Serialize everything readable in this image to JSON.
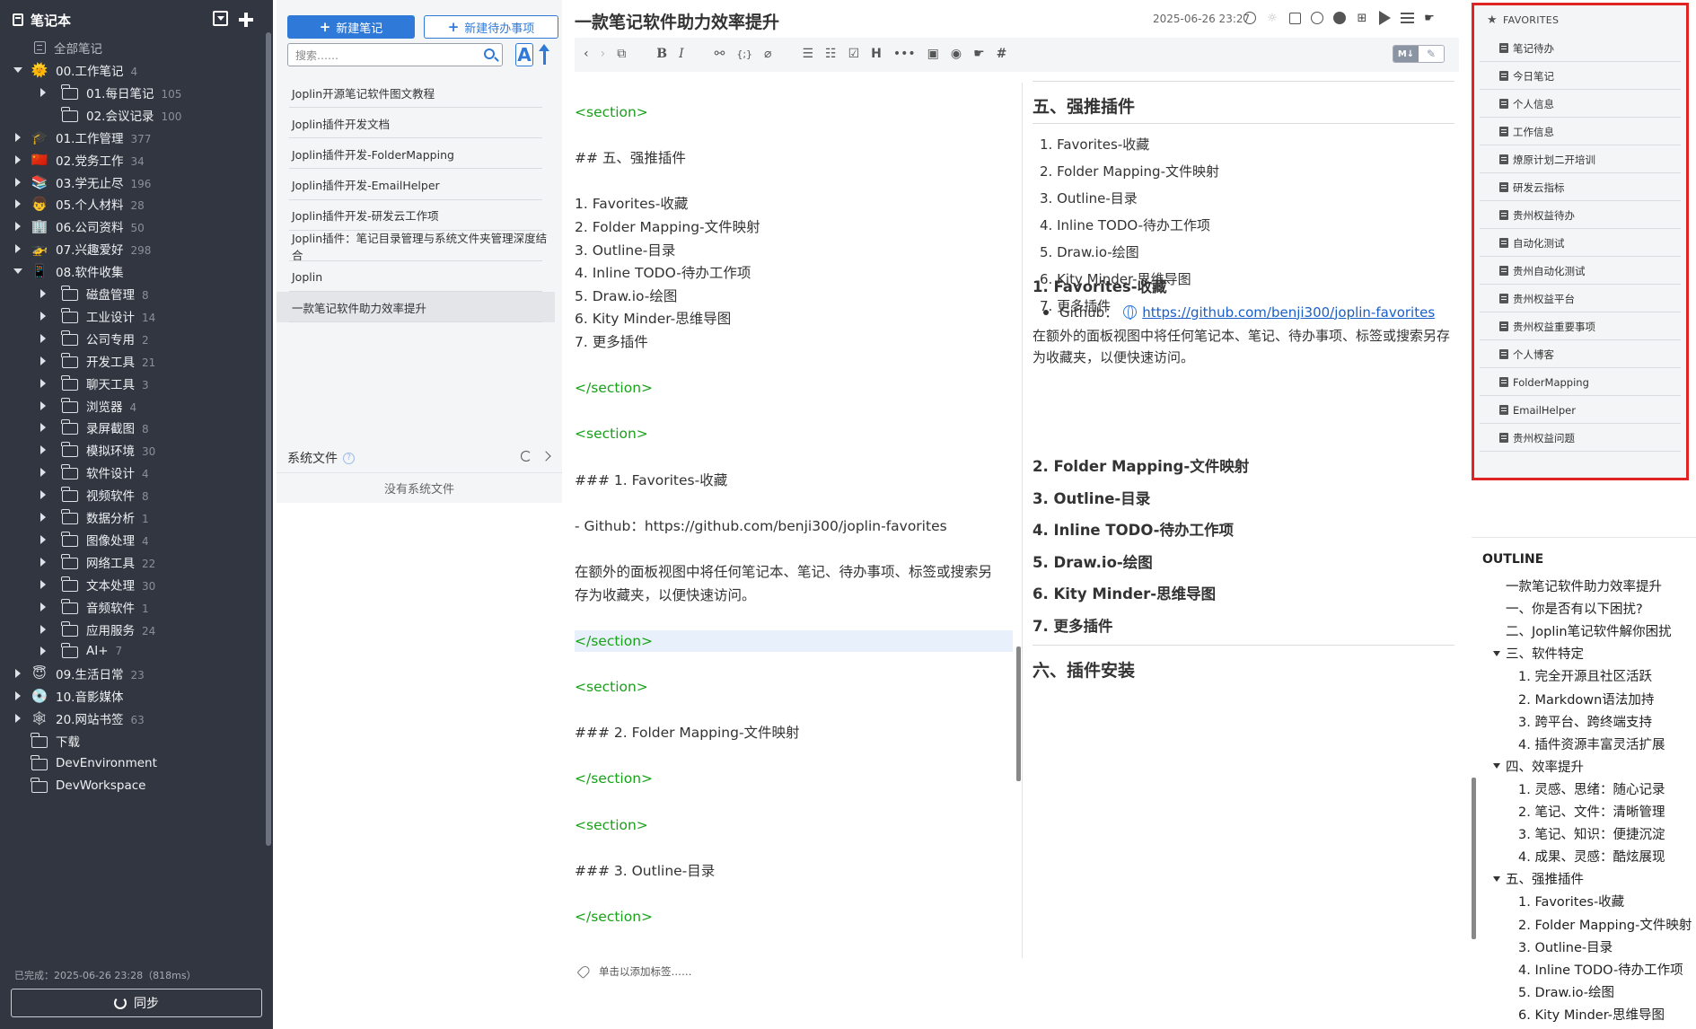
{
  "sidebar": {
    "title": "笔记本",
    "all_notes": "全部笔记",
    "status": "已完成：2025-06-26 23:28（818ms）",
    "sync_label": "同步",
    "tree": [
      {
        "label": "00.工作笔记",
        "count": "4",
        "icon": "sun-emoji",
        "glyph": "🌞",
        "level": 0,
        "toggle": "open"
      },
      {
        "label": "01.每日笔记",
        "count": "105",
        "icon": "folder-icon",
        "level": 1,
        "toggle": "closed"
      },
      {
        "label": "02.会议记录",
        "count": "100",
        "icon": "folder-icon",
        "level": 1,
        "toggle": "none"
      },
      {
        "label": "01.工作管理",
        "count": "377",
        "icon": "graduation-cap-emoji",
        "glyph": "🎓",
        "level": 0,
        "toggle": "closed"
      },
      {
        "label": "02.党务工作",
        "count": "34",
        "icon": "china-flag-emoji",
        "glyph": "🇨🇳",
        "level": 0,
        "toggle": "closed"
      },
      {
        "label": "03.学无止尽",
        "count": "196",
        "icon": "books-emoji",
        "glyph": "📚",
        "level": 0,
        "toggle": "closed"
      },
      {
        "label": "05.个人材料",
        "count": "28",
        "icon": "person-emoji",
        "glyph": "👦",
        "level": 0,
        "toggle": "closed"
      },
      {
        "label": "06.公司资料",
        "count": "50",
        "icon": "office-building-emoji",
        "glyph": "🏢",
        "level": 0,
        "toggle": "closed"
      },
      {
        "label": "07.兴趣爱好",
        "count": "298",
        "icon": "helicopter-emoji",
        "glyph": "🚁",
        "level": 0,
        "toggle": "closed"
      },
      {
        "label": "08.软件收集",
        "count": "",
        "icon": "mobile-phone-emoji",
        "glyph": "📱",
        "level": 0,
        "toggle": "open"
      },
      {
        "label": "磁盘管理",
        "count": "8",
        "icon": "folder-icon",
        "level": 1,
        "toggle": "closed"
      },
      {
        "label": "工业设计",
        "count": "14",
        "icon": "folder-icon",
        "level": 1,
        "toggle": "closed"
      },
      {
        "label": "公司专用",
        "count": "2",
        "icon": "folder-icon",
        "level": 1,
        "toggle": "closed"
      },
      {
        "label": "开发工具",
        "count": "21",
        "icon": "folder-icon",
        "level": 1,
        "toggle": "closed"
      },
      {
        "label": "聊天工具",
        "count": "3",
        "icon": "folder-icon",
        "level": 1,
        "toggle": "closed"
      },
      {
        "label": "浏览器",
        "count": "4",
        "icon": "folder-icon",
        "level": 1,
        "toggle": "closed"
      },
      {
        "label": "录屏截图",
        "count": "8",
        "icon": "folder-icon",
        "level": 1,
        "toggle": "closed"
      },
      {
        "label": "模拟环境",
        "count": "30",
        "icon": "folder-icon",
        "level": 1,
        "toggle": "closed"
      },
      {
        "label": "软件设计",
        "count": "4",
        "icon": "folder-icon",
        "level": 1,
        "toggle": "closed"
      },
      {
        "label": "视频软件",
        "count": "8",
        "icon": "folder-icon",
        "level": 1,
        "toggle": "closed"
      },
      {
        "label": "数据分析",
        "count": "1",
        "icon": "folder-icon",
        "level": 1,
        "toggle": "closed"
      },
      {
        "label": "图像处理",
        "count": "4",
        "icon": "folder-icon",
        "level": 1,
        "toggle": "closed"
      },
      {
        "label": "网络工具",
        "count": "22",
        "icon": "folder-icon",
        "level": 1,
        "toggle": "closed"
      },
      {
        "label": "文本处理",
        "count": "30",
        "icon": "folder-icon",
        "level": 1,
        "toggle": "closed"
      },
      {
        "label": "音频软件",
        "count": "1",
        "icon": "folder-icon",
        "level": 1,
        "toggle": "closed"
      },
      {
        "label": "应用服务",
        "count": "24",
        "icon": "folder-icon",
        "level": 1,
        "toggle": "closed"
      },
      {
        "label": "AI+",
        "count": "7",
        "icon": "folder-icon",
        "level": 1,
        "toggle": "closed"
      },
      {
        "label": "09.生活日常",
        "count": "23",
        "icon": "halo-face-emoji",
        "glyph": "😇",
        "level": 0,
        "toggle": "closed"
      },
      {
        "label": "10.音影媒体",
        "count": "",
        "icon": "disc-emoji",
        "glyph": "💿",
        "level": 0,
        "toggle": "closed"
      },
      {
        "label": "20.网站书签",
        "count": "63",
        "icon": "spider-web-emoji",
        "glyph": "🕸",
        "level": 0,
        "toggle": "closed"
      },
      {
        "label": "下载",
        "count": "",
        "icon": "folder-icon",
        "level": 0,
        "toggle": "none"
      },
      {
        "label": "DevEnvironment",
        "count": "",
        "icon": "folder-icon",
        "level": 0,
        "toggle": "none"
      },
      {
        "label": "DevWorkspace",
        "count": "",
        "icon": "folder-icon",
        "level": 0,
        "toggle": "none"
      }
    ]
  },
  "notelist": {
    "new_note": "新建笔记",
    "new_todo": "新建待办事项",
    "search_placeholder": "搜索……",
    "notes": [
      "Joplin开源笔记软件图文教程",
      "Joplin插件开发文档",
      "Joplin插件开发-FolderMapping",
      "Joplin插件开发-EmailHelper",
      "Joplin插件开发-研发云工作项",
      "Joplin插件：笔记目录管理与系统文件夹管理深度结合",
      "Joplin",
      "一款笔记软件助力效率提升"
    ],
    "selected_index": 7,
    "system_files_title": "系统文件",
    "system_files_empty": "没有系统文件"
  },
  "editor": {
    "title": "一款笔记软件助力效率提升",
    "date": "2025-06-26 23:27",
    "toggle_md": "M↓",
    "tag_hint": "单击以添加标签……",
    "code_lines": [
      {
        "text": "<section>",
        "kind": "tag"
      },
      {
        "text": "",
        "kind": "text"
      },
      {
        "text": "## 五、强推插件",
        "kind": "text"
      },
      {
        "text": "",
        "kind": "text"
      },
      {
        "text": "1.  Favorites-收藏",
        "kind": "text"
      },
      {
        "text": "2.  Folder Mapping-文件映射",
        "kind": "text"
      },
      {
        "text": "3.  Outline-目录",
        "kind": "text"
      },
      {
        "text": "4. Inline TODO-待办工作项",
        "kind": "text"
      },
      {
        "text": "5.  Draw.io-绘图",
        "kind": "text"
      },
      {
        "text": "6.  Kity Minder-思维导图",
        "kind": "text"
      },
      {
        "text": "7. 更多插件",
        "kind": "text"
      },
      {
        "text": "",
        "kind": "text"
      },
      {
        "text": "</section>",
        "kind": "tag"
      },
      {
        "text": "",
        "kind": "text"
      },
      {
        "text": "<section>",
        "kind": "tag"
      },
      {
        "text": "",
        "kind": "text"
      },
      {
        "text": "### 1.  Favorites-收藏",
        "kind": "text"
      },
      {
        "text": "",
        "kind": "text"
      },
      {
        "text": "- Github：https://github.com/benji300/joplin-favorites",
        "kind": "text"
      },
      {
        "text": "",
        "kind": "text"
      },
      {
        "text": "在额外的面板视图中将任何笔记本、笔记、待办事项、标签或搜索另",
        "kind": "text"
      },
      {
        "text": "存为收藏夹，以便快速访问。",
        "kind": "text"
      },
      {
        "text": "",
        "kind": "text"
      },
      {
        "text": "</section>",
        "kind": "tag-hl"
      },
      {
        "text": "",
        "kind": "text"
      },
      {
        "text": "<section>",
        "kind": "tag"
      },
      {
        "text": "",
        "kind": "text"
      },
      {
        "text": "### 2.  Folder Mapping-文件映射",
        "kind": "text"
      },
      {
        "text": "",
        "kind": "text"
      },
      {
        "text": "</section>",
        "kind": "tag"
      },
      {
        "text": "",
        "kind": "text"
      },
      {
        "text": "<section>",
        "kind": "tag"
      },
      {
        "text": "",
        "kind": "text"
      },
      {
        "text": "### 3.  Outline-目录",
        "kind": "text"
      },
      {
        "text": "",
        "kind": "text"
      },
      {
        "text": "</section>",
        "kind": "tag"
      }
    ],
    "preview": {
      "h2": "五、强推插件",
      "list": [
        "1. Favorites-收藏",
        "2. Folder Mapping-文件映射",
        "3. Outline-目录",
        "4. Inline TODO-待办工作项",
        "5. Draw.io-绘图",
        "6. Kity Minder-思维导图",
        "7. 更多插件"
      ],
      "h3_1": "1. Favorites-收藏",
      "github_label": "Github：",
      "github_url": "https://github.com/benji300/joplin-favorites",
      "paragraph": "在额外的面板视图中将任何笔记本、笔记、待办事项、标签或搜索另存为收藏夹，以便快速访问。",
      "h3_rest": [
        "2. Folder Mapping-文件映射",
        "3. Outline-目录",
        "4. Inline TODO-待办工作项",
        "5. Draw.io-绘图",
        "6. Kity Minder-思维导图",
        "7. 更多插件"
      ],
      "h2_next": "六、插件安装"
    }
  },
  "favorites": {
    "title": "FAVORITES",
    "items": [
      "笔记待办",
      "今日笔记",
      "个人信息",
      "工作信息",
      "燎原计划二开培训",
      "研发云指标",
      "贵州权益待办",
      "自动化测试",
      "贵州自动化测试",
      "贵州权益平台",
      "贵州权益重要事项",
      "个人博客",
      "FolderMapping",
      "EmailHelper",
      "贵州权益问题"
    ]
  },
  "outline": {
    "title": "OUTLINE",
    "items": [
      {
        "text": "一款笔记软件助力效率提升",
        "level": 0,
        "toggle": false
      },
      {
        "text": "一、你是否有以下困扰?",
        "level": 1,
        "toggle": false
      },
      {
        "text": "二、Joplin笔记软件解你困扰",
        "level": 1,
        "toggle": false
      },
      {
        "text": "三、软件特定",
        "level": 1,
        "toggle": true
      },
      {
        "text": "1. 完全开源且社区活跃",
        "level": 2,
        "toggle": false
      },
      {
        "text": "2. Markdown语法加持",
        "level": 2,
        "toggle": false
      },
      {
        "text": "3. 跨平台、跨终端支持",
        "level": 2,
        "toggle": false
      },
      {
        "text": "4. 插件资源丰富灵活扩展",
        "level": 2,
        "toggle": false
      },
      {
        "text": "四、效率提升",
        "level": 1,
        "toggle": true
      },
      {
        "text": "1. 灵感、思绪：随心记录",
        "level": 2,
        "toggle": false
      },
      {
        "text": "2. 笔记、文件：清晰管理",
        "level": 2,
        "toggle": false
      },
      {
        "text": "3. 笔记、知识：便捷沉淀",
        "level": 2,
        "toggle": false
      },
      {
        "text": "4. 成果、灵感：酷炫展现",
        "level": 2,
        "toggle": false
      },
      {
        "text": "五、强推插件",
        "level": 1,
        "toggle": true
      },
      {
        "text": "1. Favorites-收藏",
        "level": 2,
        "toggle": false
      },
      {
        "text": "2. Folder Mapping-文件映射",
        "level": 2,
        "toggle": false
      },
      {
        "text": "3. Outline-目录",
        "level": 2,
        "toggle": false
      },
      {
        "text": "4. Inline TODO-待办工作项",
        "level": 2,
        "toggle": false
      },
      {
        "text": "5. Draw.io-绘图",
        "level": 2,
        "toggle": false
      },
      {
        "text": "6. Kity Minder-思维导图",
        "level": 2,
        "toggle": false
      }
    ]
  }
}
